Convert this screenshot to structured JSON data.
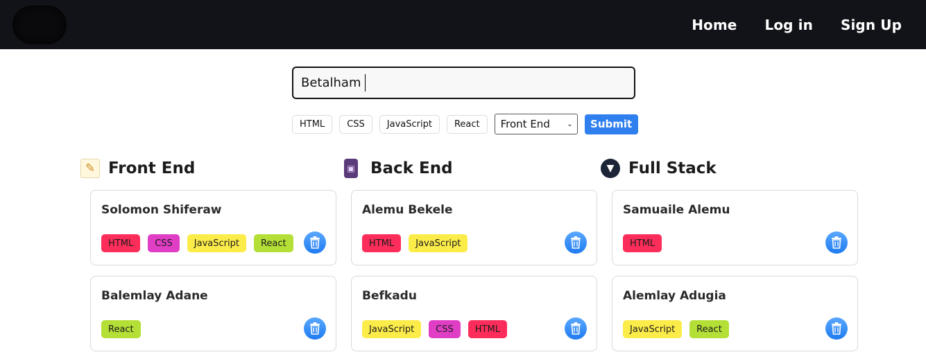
{
  "nav": {
    "links": [
      "Home",
      "Log in",
      "Sign Up"
    ]
  },
  "form": {
    "input_value": "Betalham",
    "tags": [
      "HTML",
      "CSS",
      "JavaScript",
      "React"
    ],
    "select_value": "Front End",
    "submit_label": "Submit"
  },
  "columns": [
    {
      "title": "Front End",
      "icon": "memo-icon",
      "cards": [
        {
          "name": "Solomon Shiferaw",
          "tags": [
            "HTML",
            "CSS",
            "JavaScript",
            "React"
          ]
        },
        {
          "name": "Balemlay Adane",
          "tags": [
            "React"
          ]
        }
      ]
    },
    {
      "title": "Back End",
      "icon": "mobile-phone-icon",
      "cards": [
        {
          "name": "Alemu Bekele",
          "tags": [
            "HTML",
            "JavaScript"
          ]
        },
        {
          "name": "Befkadu",
          "tags": [
            "JavaScript",
            "CSS",
            "HTML"
          ]
        }
      ]
    },
    {
      "title": "Full Stack",
      "icon": "basket-icon",
      "cards": [
        {
          "name": "Samuaile Alemu",
          "tags": [
            "HTML"
          ]
        },
        {
          "name": "Alemlay Adugia",
          "tags": [
            "JavaScript",
            "React"
          ]
        }
      ]
    }
  ],
  "colors": {
    "navbar": "#121318",
    "submit": "#2f7fee",
    "html_tag": "#fc2d5a",
    "css_tag": "#e03ec5",
    "javascript_tag": "#fcec4a",
    "react_tag": "#b4df37",
    "delete_button": "#2f8cf5"
  }
}
